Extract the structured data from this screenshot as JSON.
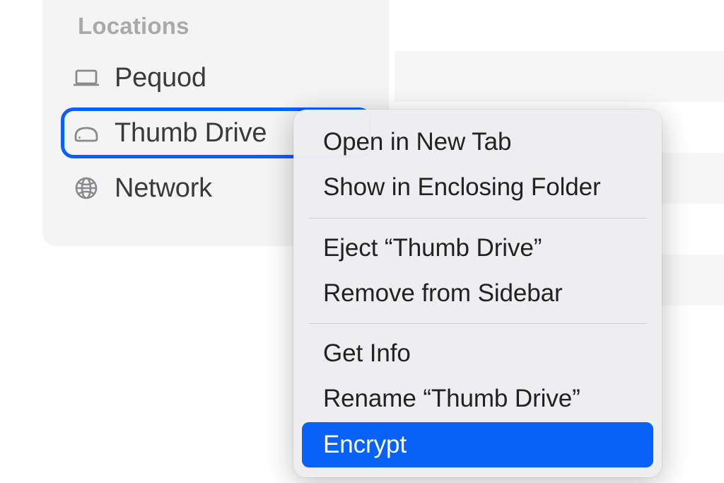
{
  "sidebar": {
    "section_header": "Locations",
    "items": [
      {
        "label": "Pequod",
        "icon": "laptop-icon",
        "selected": false
      },
      {
        "label": "Thumb Drive",
        "icon": "drive-icon",
        "selected": true
      },
      {
        "label": "Network",
        "icon": "globe-icon",
        "selected": false
      }
    ]
  },
  "context_menu": {
    "groups": [
      [
        {
          "label": "Open in New Tab"
        },
        {
          "label": "Show in Enclosing Folder"
        }
      ],
      [
        {
          "label": "Eject “Thumb Drive”"
        },
        {
          "label": "Remove from Sidebar"
        }
      ],
      [
        {
          "label": "Get Info"
        },
        {
          "label": "Rename “Thumb Drive”"
        },
        {
          "label": "Encrypt",
          "highlighted": true
        }
      ]
    ]
  },
  "colors": {
    "selection_ring": "#0A5FFF",
    "menu_highlight": "#0862F7"
  }
}
